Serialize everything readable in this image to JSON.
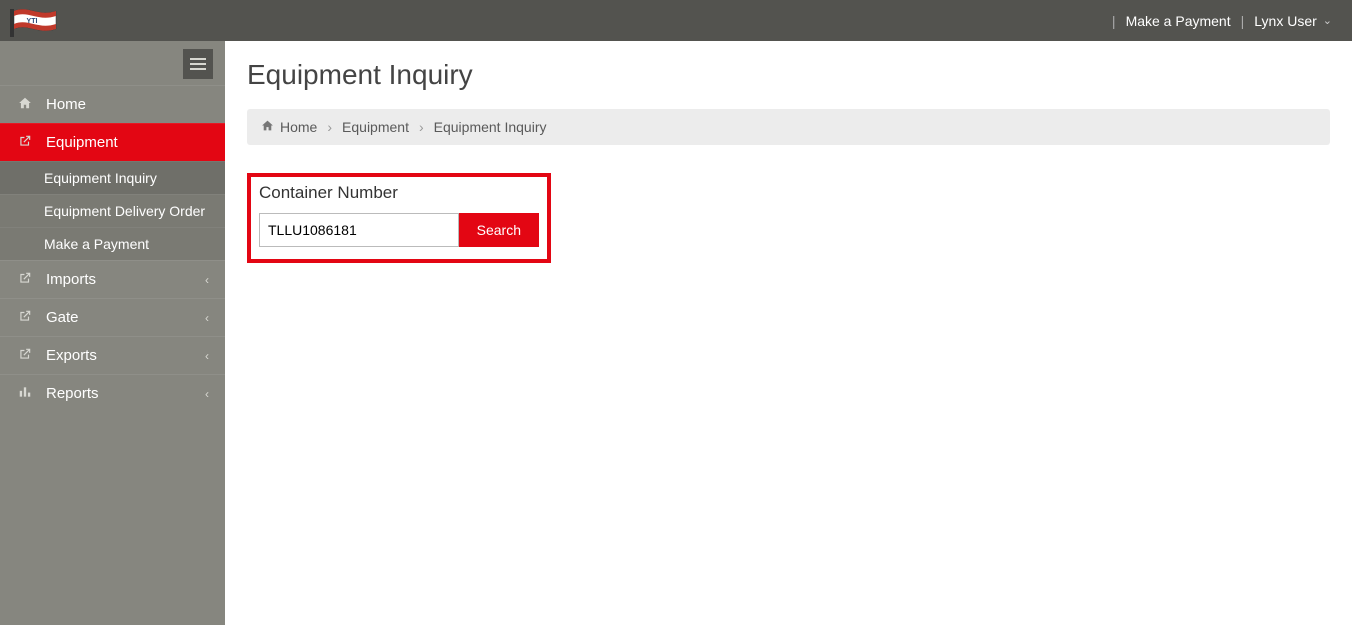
{
  "topbar": {
    "payment_link": "Make a Payment",
    "user_label": "Lynx User"
  },
  "sidebar": {
    "items": [
      {
        "icon": "home-icon",
        "label": "Home"
      },
      {
        "icon": "external-link-icon",
        "label": "Equipment"
      },
      {
        "icon": "external-link-icon",
        "label": "Imports"
      },
      {
        "icon": "external-link-icon",
        "label": "Gate"
      },
      {
        "icon": "external-link-icon",
        "label": "Exports"
      },
      {
        "icon": "bar-chart-icon",
        "label": "Reports"
      }
    ],
    "equipment_sub": [
      "Equipment Inquiry",
      "Equipment Delivery Order",
      "Make a Payment"
    ]
  },
  "page": {
    "title": "Equipment Inquiry",
    "breadcrumb": {
      "item1": "Home",
      "item2": "Equipment",
      "item3": "Equipment Inquiry"
    },
    "search": {
      "field_label": "Container Number",
      "value": "TLLU1086181",
      "button_label": "Search"
    }
  }
}
